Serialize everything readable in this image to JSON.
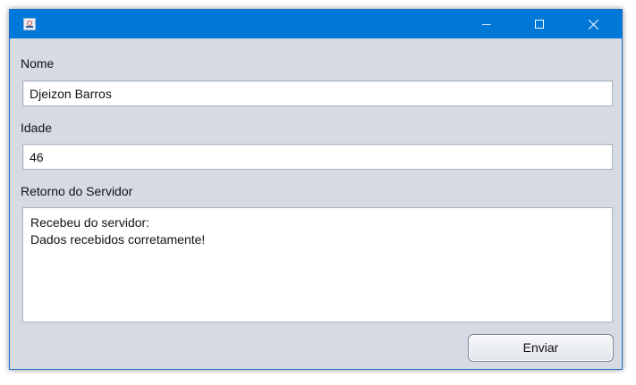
{
  "window": {
    "title": "",
    "accent_color": "#0078d7",
    "background_color": "#d6dbe3",
    "icons": {
      "app": "java-app-icon",
      "minimize": "minimize-icon",
      "maximize": "maximize-icon",
      "close": "close-icon"
    }
  },
  "form": {
    "nome_label": "Nome",
    "nome_value": "Djeizon Barros",
    "idade_label": "Idade",
    "idade_value": "46",
    "retorno_label": "Retorno do Servidor",
    "retorno_lines": [
      "Recebeu do servidor:",
      "Dados recebidos corretamente!"
    ],
    "submit_label": "Enviar"
  }
}
